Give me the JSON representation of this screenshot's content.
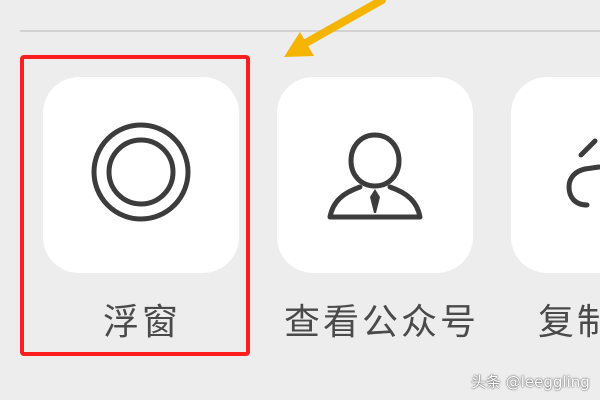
{
  "share_menu": {
    "items": [
      {
        "label": "浮窗",
        "icon": "floating-window-icon",
        "highlighted": true
      },
      {
        "label": "查看公众号",
        "icon": "official-account-person-icon"
      },
      {
        "label": "复制",
        "icon": "copy-link-icon"
      }
    ]
  },
  "watermark": {
    "text": "头条 @leeggling"
  },
  "colors": {
    "background": "#ededed",
    "tile": "#ffffff",
    "icon": "#3c3c3c",
    "label": "#4a4a4a",
    "highlight_box": "#ff1e1e",
    "arrow": "#f5b400",
    "divider": "#d2d2d2"
  }
}
